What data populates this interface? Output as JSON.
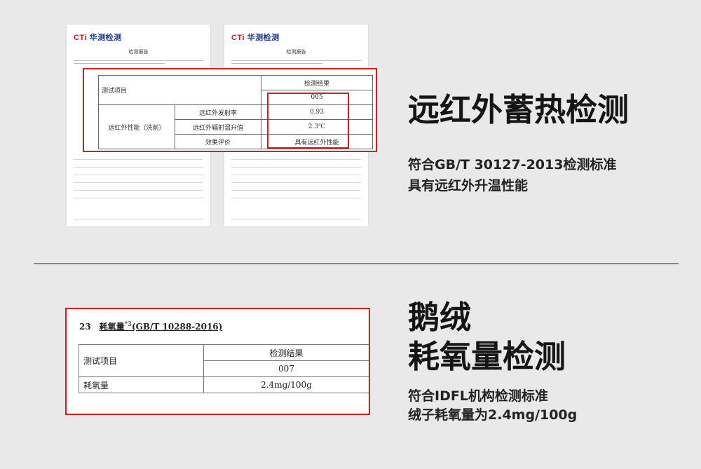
{
  "reports": [
    {
      "logo_prefix": "CTi",
      "logo_rest": " 华测检测",
      "title": "检测报告"
    },
    {
      "logo_prefix": "CTi",
      "logo_rest": " 华测检测",
      "title": "检测报告"
    }
  ],
  "zoom_table": {
    "col_result": "检测结果",
    "code": "005",
    "item": "测试项目",
    "group": "远红外性能（洗前）",
    "rows": [
      {
        "label": "远红外发射率",
        "value": "0.93"
      },
      {
        "label": "远红外辐射温升值",
        "value": "2.3℃"
      },
      {
        "label": "效果评价",
        "value": "具有远红外性能"
      }
    ]
  },
  "section1": {
    "heading": "远红外蓄热检测",
    "line1": "符合GB/T 30127-2013检测标准",
    "line2": "具有远红外升温性能"
  },
  "down_table": {
    "number": "23",
    "name": "耗氧量",
    "sup": "*3",
    "standard": "(GB/T 10288-2016)",
    "col_item": "测试项目",
    "col_result": "检测结果",
    "code": "007",
    "row_label": "耗氧量",
    "row_value": "2.4mg/100g"
  },
  "section2": {
    "heading_line1": "鹅绒",
    "heading_line2": "耗氧量检测",
    "line1": "符合IDFL机构检测标准",
    "line2": "绒子耗氧量为2.4mg/100g"
  }
}
